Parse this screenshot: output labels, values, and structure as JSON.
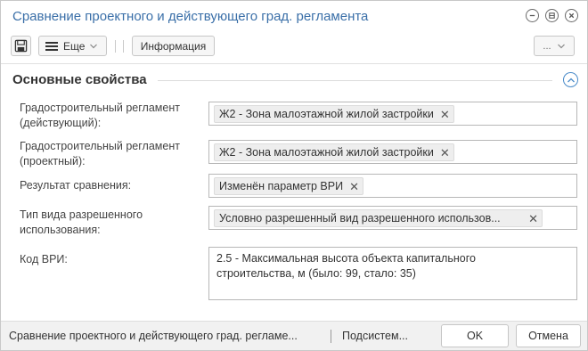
{
  "window": {
    "title": "Сравнение проектного и действующего град. регламента"
  },
  "toolbar": {
    "save_icon": "floppy-disk-icon",
    "more_label": "Еще",
    "info_label": "Информация",
    "right_menu_label": "..."
  },
  "group": {
    "title": "Основные свойства"
  },
  "fields": [
    {
      "label_line1": "Градостроительный регламент",
      "label_line2": "(действующий):",
      "value": "Ж2 - Зона малоэтажной жилой застройки"
    },
    {
      "label_line1": "Градостроительный регламент",
      "label_line2": "(проектный):",
      "value": "Ж2 - Зона малоэтажной жилой застройки"
    },
    {
      "label_line1": "Результат сравнения:",
      "label_line2": "",
      "value": "Изменён параметр ВРИ"
    },
    {
      "label_line1": "Тип вида разрешенного",
      "label_line2": "использования:",
      "value": "Условно разрешенный вид разрешенного использов..."
    }
  ],
  "code_field": {
    "label": "Код ВРИ:",
    "line1": "2.5 - Максимальная высота объекта капитального",
    "line2": "строительства, м (было: 99, стало: 35)"
  },
  "statusbar": {
    "text": "Сравнение проектного и действующего град. регламе...",
    "subsystem": "Подсистем...",
    "ok_label": "OK",
    "cancel_label": "Отмена"
  },
  "colors": {
    "title": "#3a6fa8",
    "accent": "#4a8bc9"
  }
}
